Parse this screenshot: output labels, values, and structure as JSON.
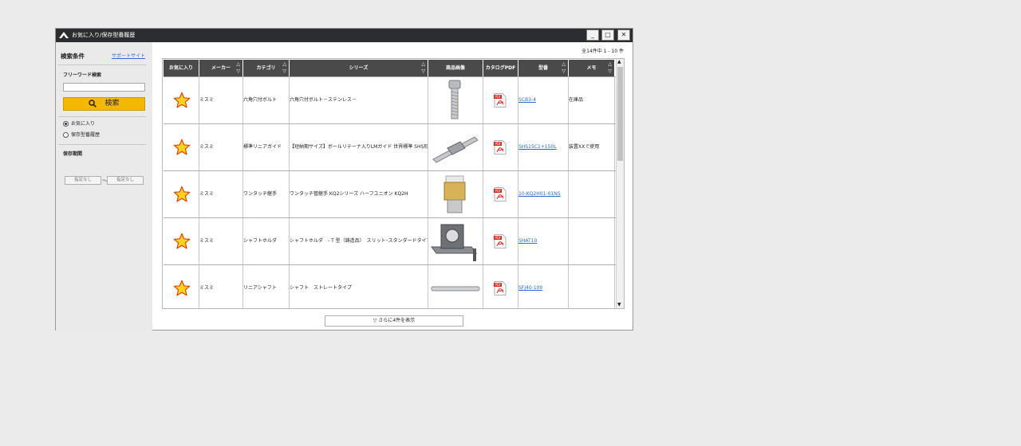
{
  "window": {
    "title": "お気に入り/保存型番履歴",
    "controls": [
      "_",
      "□",
      "✕"
    ]
  },
  "sidebar": {
    "heading": "検索条件",
    "support_link": "サポートサイト",
    "freeword_label": "フリーワード検索",
    "freeword_value": "",
    "search_button": "検索",
    "radio_options": [
      {
        "label": "お気に入り",
        "checked": true
      },
      {
        "label": "保存型番履歴",
        "checked": false
      }
    ],
    "period_label": "保存期間",
    "period_from": "指定なし",
    "period_separator": "〜",
    "period_to": "指定なし"
  },
  "results": {
    "count_text": "全14件中 1 - 10 件",
    "more_button": "▽ さらに4件を表示"
  },
  "table": {
    "headers": [
      "お気に入り",
      "メーカー",
      "カテゴリ",
      "シリーズ",
      "商品画像",
      "カタログPDF",
      "型番",
      "メモ"
    ],
    "sort_arrows": {
      "up": "△",
      "down": "▽"
    },
    "rows": [
      {
        "maker": "ミスミ",
        "category": "六角穴付ボルト",
        "series": "六角穴付ボルト－ステンレス－",
        "image_icon": "hex-bolt-image",
        "pdf_icon": "pdf-icon",
        "part_no": "SCB3-4",
        "memo": "在庫品"
      },
      {
        "maker": "ミスミ",
        "category": "標準リニアガイド",
        "series": "【短納期サイズ】ボールリテーナ入りLMガイド 世界標準 SHS形",
        "image_icon": "linear-guide-image",
        "pdf_icon": "pdf-icon",
        "part_no": "SHS15C1+150L",
        "memo": "装置XXで使用"
      },
      {
        "maker": "ミスミ",
        "category": "ワンタッチ継手",
        "series": "ワンタッチ管継手 KQ2シリーズ ハーフユニオン KQ2H",
        "image_icon": "fitting-image",
        "pdf_icon": "pdf-icon",
        "part_no": "10-KQ2H01-01NS",
        "memo": ""
      },
      {
        "maker": "ミスミ",
        "category": "シャフトホルダ",
        "series": "シャフトホルダ　- T 型（鋳造品）　スリット･スタンダードタイプ",
        "image_icon": "shaft-holder-image",
        "pdf_icon": "pdf-icon",
        "part_no": "SHAT10",
        "memo": ""
      },
      {
        "maker": "ミスミ",
        "category": "リニアシャフト",
        "series": "シャフト　ストレートタイプ",
        "image_icon": "linear-shaft-image",
        "pdf_icon": "pdf-icon",
        "part_no": "SFJ40-100",
        "memo": ""
      }
    ]
  },
  "colors": {
    "titlebar": "#2b2d30",
    "sidebar": "#eaeaea",
    "search_button": "#f5b800",
    "table_header": "#4a4a4a",
    "star_fill": "#ffd21f",
    "star_stroke": "#e03b00",
    "link": "#2a6ccf"
  }
}
